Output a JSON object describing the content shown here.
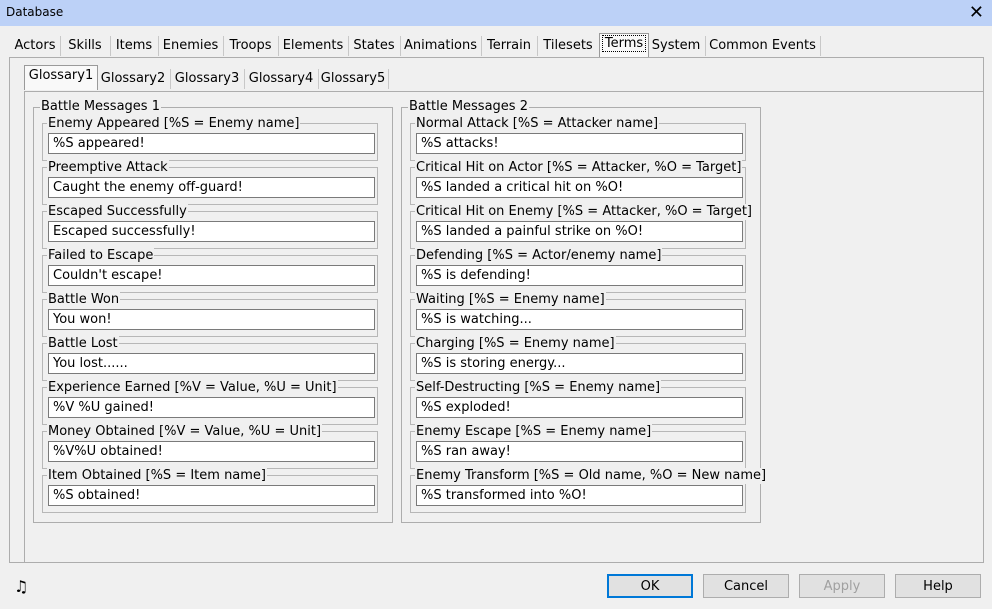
{
  "window": {
    "title": "Database",
    "close_icon": "close-icon"
  },
  "main_tabs": [
    {
      "label": "Actors"
    },
    {
      "label": "Skills"
    },
    {
      "label": "Items"
    },
    {
      "label": "Enemies"
    },
    {
      "label": "Troops"
    },
    {
      "label": "Elements"
    },
    {
      "label": "States"
    },
    {
      "label": "Animations"
    },
    {
      "label": "Terrain"
    },
    {
      "label": "Tilesets"
    },
    {
      "label": "Terms",
      "active": true
    },
    {
      "label": "System"
    },
    {
      "label": "Common Events"
    }
  ],
  "sub_tabs": [
    {
      "label": "Glossary1",
      "active": true
    },
    {
      "label": "Glossary2"
    },
    {
      "label": "Glossary3"
    },
    {
      "label": "Glossary4"
    },
    {
      "label": "Glossary5"
    }
  ],
  "group1": {
    "title": "Battle Messages 1",
    "fields": [
      {
        "label": "Enemy Appeared [%S = Enemy name]",
        "value": "%S appeared!"
      },
      {
        "label": "Preemptive Attack",
        "value": "Caught the enemy off-guard!"
      },
      {
        "label": "Escaped Successfully",
        "value": "Escaped successfully!"
      },
      {
        "label": "Failed to Escape",
        "value": "Couldn't escape!"
      },
      {
        "label": "Battle Won",
        "value": "You won!"
      },
      {
        "label": "Battle Lost",
        "value": "You lost......"
      },
      {
        "label": "Experience Earned [%V = Value, %U = Unit]",
        "value": "%V %U gained!"
      },
      {
        "label": "Money Obtained [%V = Value, %U = Unit]",
        "value": "%V%U obtained!"
      },
      {
        "label": "Item Obtained [%S = Item name]",
        "value": "%S obtained!"
      }
    ]
  },
  "group2": {
    "title": "Battle Messages 2",
    "fields": [
      {
        "label": "Normal Attack [%S = Attacker name]",
        "value": "%S attacks!"
      },
      {
        "label": "Critical Hit on Actor [%S = Attacker, %O = Target]",
        "value": "%S landed a critical hit on %O!"
      },
      {
        "label": "Critical Hit on Enemy [%S = Attacker, %O = Target]",
        "value": "%S landed a painful strike on %O!"
      },
      {
        "label": "Defending [%S = Actor/enemy name]",
        "value": "%S is defending!"
      },
      {
        "label": "Waiting [%S = Enemy name]",
        "value": "%S is watching..."
      },
      {
        "label": "Charging [%S = Enemy name]",
        "value": "%S is storing energy..."
      },
      {
        "label": "Self-Destructing [%S = Enemy name]",
        "value": "%S exploded!"
      },
      {
        "label": "Enemy Escape [%S = Enemy name]",
        "value": "%S ran away!"
      },
      {
        "label": "Enemy Transform [%S = Old name, %O = New name]",
        "value": "%S transformed into %O!"
      }
    ]
  },
  "footer": {
    "music_icon": "music-note-icon",
    "ok_label": "OK",
    "cancel_label": "Cancel",
    "apply_label": "Apply",
    "help_label": "Help"
  }
}
